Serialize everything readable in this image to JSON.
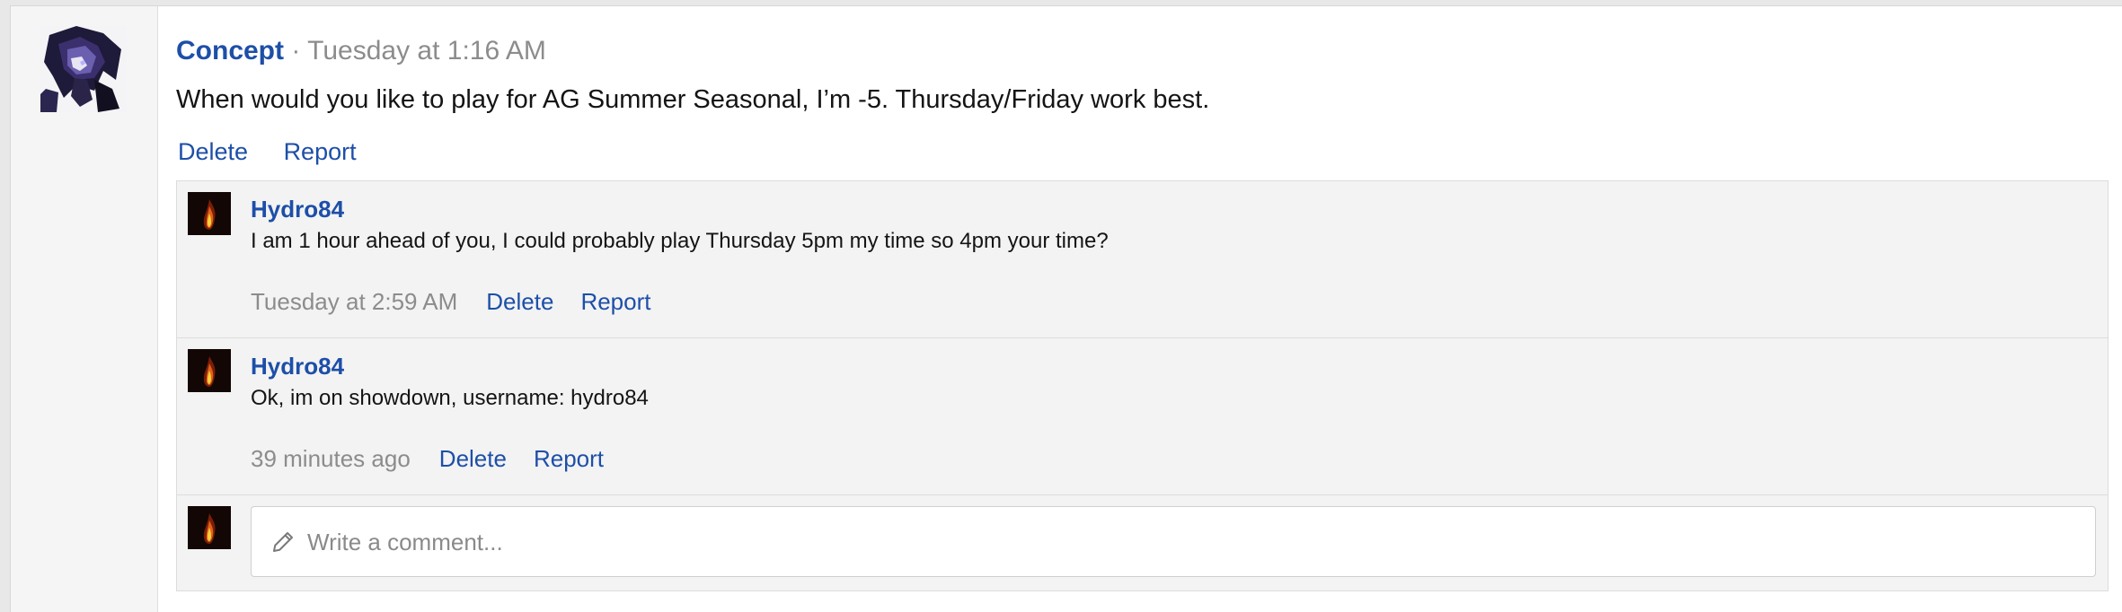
{
  "post": {
    "author": "Concept",
    "separator": " · ",
    "time": "Tuesday at 1:16 AM",
    "body": "When would you like to play for AG Summer Seasonal, I’m -5. Thursday/Friday work best.",
    "actions": {
      "delete": "Delete",
      "report": "Report"
    }
  },
  "comments": [
    {
      "author": "Hydro84",
      "text": "I am 1 hour ahead of you, I could probably play Thursday 5pm my time so 4pm your time?",
      "time": "Tuesday at 2:59 AM",
      "delete": "Delete",
      "report": "Report"
    },
    {
      "author": "Hydro84",
      "text": "Ok, im on showdown, username: hydro84",
      "time": "39 minutes ago",
      "delete": "Delete",
      "report": "Report"
    }
  ],
  "composer": {
    "placeholder": "Write a comment...",
    "icon": "pencil-icon"
  },
  "colors": {
    "link": "#1d4fa8",
    "muted": "#8c8c8c",
    "comment_bg": "#f3f3f3"
  }
}
